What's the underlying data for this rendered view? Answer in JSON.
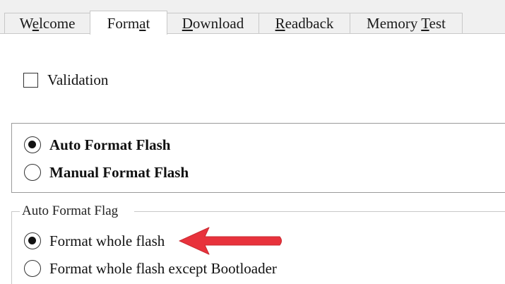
{
  "tabs": [
    {
      "pre": "W",
      "accel": "e",
      "post": "lcome",
      "active": false
    },
    {
      "pre": "Form",
      "accel": "a",
      "post": "t",
      "active": true
    },
    {
      "pre": "",
      "accel": "D",
      "post": "ownload",
      "active": false
    },
    {
      "pre": "",
      "accel": "R",
      "post": "eadback",
      "active": false
    },
    {
      "pre": "Memory ",
      "accel": "T",
      "post": "est",
      "active": false
    }
  ],
  "validation": {
    "label": "Validation",
    "checked": false
  },
  "format_mode": {
    "options": [
      {
        "label": "Auto Format Flash",
        "selected": true
      },
      {
        "label": "Manual Format Flash",
        "selected": false
      }
    ]
  },
  "auto_format_flag": {
    "legend": "Auto Format Flag",
    "options": [
      {
        "label": "Format whole flash",
        "selected": true
      },
      {
        "label": "Format whole flash except Bootloader",
        "selected": false
      }
    ]
  },
  "annotation": {
    "arrow_color": "#e8323c"
  }
}
